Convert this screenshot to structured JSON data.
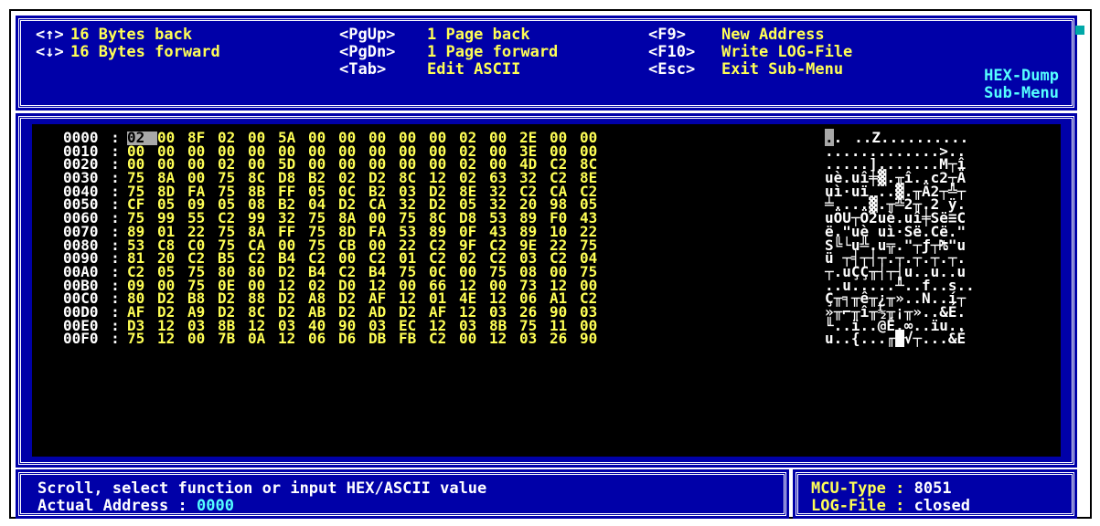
{
  "help": {
    "rows": [
      [
        {
          "key": "<↑>",
          "desc": "16 Bytes back"
        },
        {
          "key": "<PgUp>",
          "desc": "1 Page back"
        },
        {
          "key": "<F9>",
          "desc": "New Address"
        }
      ],
      [
        {
          "key": "<↓>",
          "desc": "16 Bytes forward"
        },
        {
          "key": "<PgDn>",
          "desc": "1 Page forward"
        },
        {
          "key": "<F10>",
          "desc": "Write LOG-File"
        }
      ],
      [
        {
          "key": "",
          "desc": ""
        },
        {
          "key": "<Tab>",
          "desc": "Edit ASCII"
        },
        {
          "key": "<Esc>",
          "desc": "Exit Sub-Menu"
        }
      ]
    ],
    "title_line1": "HEX-Dump",
    "title_line2": "Sub-Menu"
  },
  "dump": {
    "rows": [
      {
        "addr": "0000",
        "bytes": [
          "02",
          "00",
          "8F",
          "02",
          "00",
          "5A",
          "00",
          "00",
          "00",
          "00",
          "00",
          "02",
          "00",
          "2E",
          "00",
          "00"
        ],
        "ascii": "....Z.........."
      },
      {
        "addr": "0010",
        "bytes": [
          "00",
          "00",
          "00",
          "00",
          "00",
          "00",
          "00",
          "00",
          "00",
          "00",
          "00",
          "02",
          "00",
          "3E",
          "00",
          "00"
        ],
        "ascii": ".............>.."
      },
      {
        "addr": "0020",
        "bytes": [
          "00",
          "00",
          "00",
          "02",
          "00",
          "5D",
          "00",
          "00",
          "00",
          "00",
          "00",
          "02",
          "00",
          "4D",
          "C2",
          "8C"
        ],
        "ascii": ".....].......M┬î"
      },
      {
        "addr": "0030",
        "bytes": [
          "75",
          "8A",
          "00",
          "75",
          "8C",
          "D8",
          "B2",
          "02",
          "D2",
          "8C",
          "12",
          "02",
          "63",
          "32",
          "C2",
          "8E"
        ],
        "ascii": "uè.uî╪▓.╥î..c2┬Ä"
      },
      {
        "addr": "0040",
        "bytes": [
          "75",
          "8D",
          "FA",
          "75",
          "8B",
          "FF",
          "05",
          "0C",
          "B2",
          "03",
          "D2",
          "8E",
          "32",
          "C2",
          "CA",
          "C2"
        ],
        "ascii": "uì·uï ..▓.╥Ä2┬╩┬"
      },
      {
        "addr": "0050",
        "bytes": [
          "CF",
          "05",
          "09",
          "05",
          "08",
          "B2",
          "04",
          "D2",
          "CA",
          "32",
          "D2",
          "05",
          "32",
          "20",
          "98",
          "05"
        ],
        "ascii": "╧....▓.╥╩2╥.2 ÿ."
      },
      {
        "addr": "0060",
        "bytes": [
          "75",
          "99",
          "55",
          "C2",
          "99",
          "32",
          "75",
          "8A",
          "00",
          "75",
          "8C",
          "D8",
          "53",
          "89",
          "F0",
          "43"
        ],
        "ascii": "uÖU┬Ö2uè.uî╪Së≡C"
      },
      {
        "addr": "0070",
        "bytes": [
          "89",
          "01",
          "22",
          "75",
          "8A",
          "FF",
          "75",
          "8D",
          "FA",
          "53",
          "89",
          "0F",
          "43",
          "89",
          "10",
          "22"
        ],
        "ascii": "ë.\"uè uì·Së.Cë.\""
      },
      {
        "addr": "0080",
        "bytes": [
          "53",
          "C8",
          "C0",
          "75",
          "CA",
          "00",
          "75",
          "CB",
          "00",
          "22",
          "C2",
          "9F",
          "C2",
          "9E",
          "22",
          "75"
        ],
        "ascii": "S╚└u╩.u╦.\"┬ƒ┬₧\"u"
      },
      {
        "addr": "0090",
        "bytes": [
          "81",
          "20",
          "C2",
          "B5",
          "C2",
          "B4",
          "C2",
          "00",
          "C2",
          "01",
          "C2",
          "02",
          "C2",
          "03",
          "C2",
          "04"
        ],
        "ascii": "ü ┬╡┬┤┬.┬.┬.┬.┬."
      },
      {
        "addr": "00A0",
        "bytes": [
          "C2",
          "05",
          "75",
          "80",
          "80",
          "D2",
          "B4",
          "C2",
          "B4",
          "75",
          "0C",
          "00",
          "75",
          "08",
          "00",
          "75"
        ],
        "ascii": "┬.uÇÇ╥┤┬┤u..u..u"
      },
      {
        "addr": "00B0",
        "bytes": [
          "09",
          "00",
          "75",
          "0E",
          "00",
          "12",
          "02",
          "D0",
          "12",
          "00",
          "66",
          "12",
          "00",
          "73",
          "12",
          "00"
        ],
        "ascii": "..u.....╨..f..s.."
      },
      {
        "addr": "00C0",
        "bytes": [
          "80",
          "D2",
          "B8",
          "D2",
          "88",
          "D2",
          "A8",
          "D2",
          "AF",
          "12",
          "01",
          "4E",
          "12",
          "06",
          "A1",
          "C2"
        ],
        "ascii": "Ç╥╕╥ê╥¿╥»..N..í┬"
      },
      {
        "addr": "00D0",
        "bytes": [
          "AF",
          "D2",
          "A9",
          "D2",
          "8C",
          "D2",
          "AB",
          "D2",
          "AD",
          "D2",
          "AF",
          "12",
          "03",
          "26",
          "90",
          "03"
        ],
        "ascii": "»╥⌐╥î╥½╥¡╥»..&É."
      },
      {
        "addr": "00E0",
        "bytes": [
          "D3",
          "12",
          "03",
          "8B",
          "12",
          "03",
          "40",
          "90",
          "03",
          "EC",
          "12",
          "03",
          "8B",
          "75",
          "11",
          "00"
        ],
        "ascii": "╙..ï..@É.∞..ïu.."
      },
      {
        "addr": "00F0",
        "bytes": [
          "75",
          "12",
          "00",
          "7B",
          "0A",
          "12",
          "06",
          "D6",
          "DB",
          "FB",
          "C2",
          "00",
          "12",
          "03",
          "26",
          "90"
        ],
        "ascii": "u..{...╓█√┬...&É"
      }
    ]
  },
  "status": {
    "line1": "Scroll, select function or input HEX/ASCII value",
    "address_label": "Actual Address : ",
    "address_value": "0000"
  },
  "info": {
    "mcu_label": "MCU-Type",
    "mcu_value": "8051",
    "log_label": "LOG-File",
    "log_value": "closed"
  }
}
